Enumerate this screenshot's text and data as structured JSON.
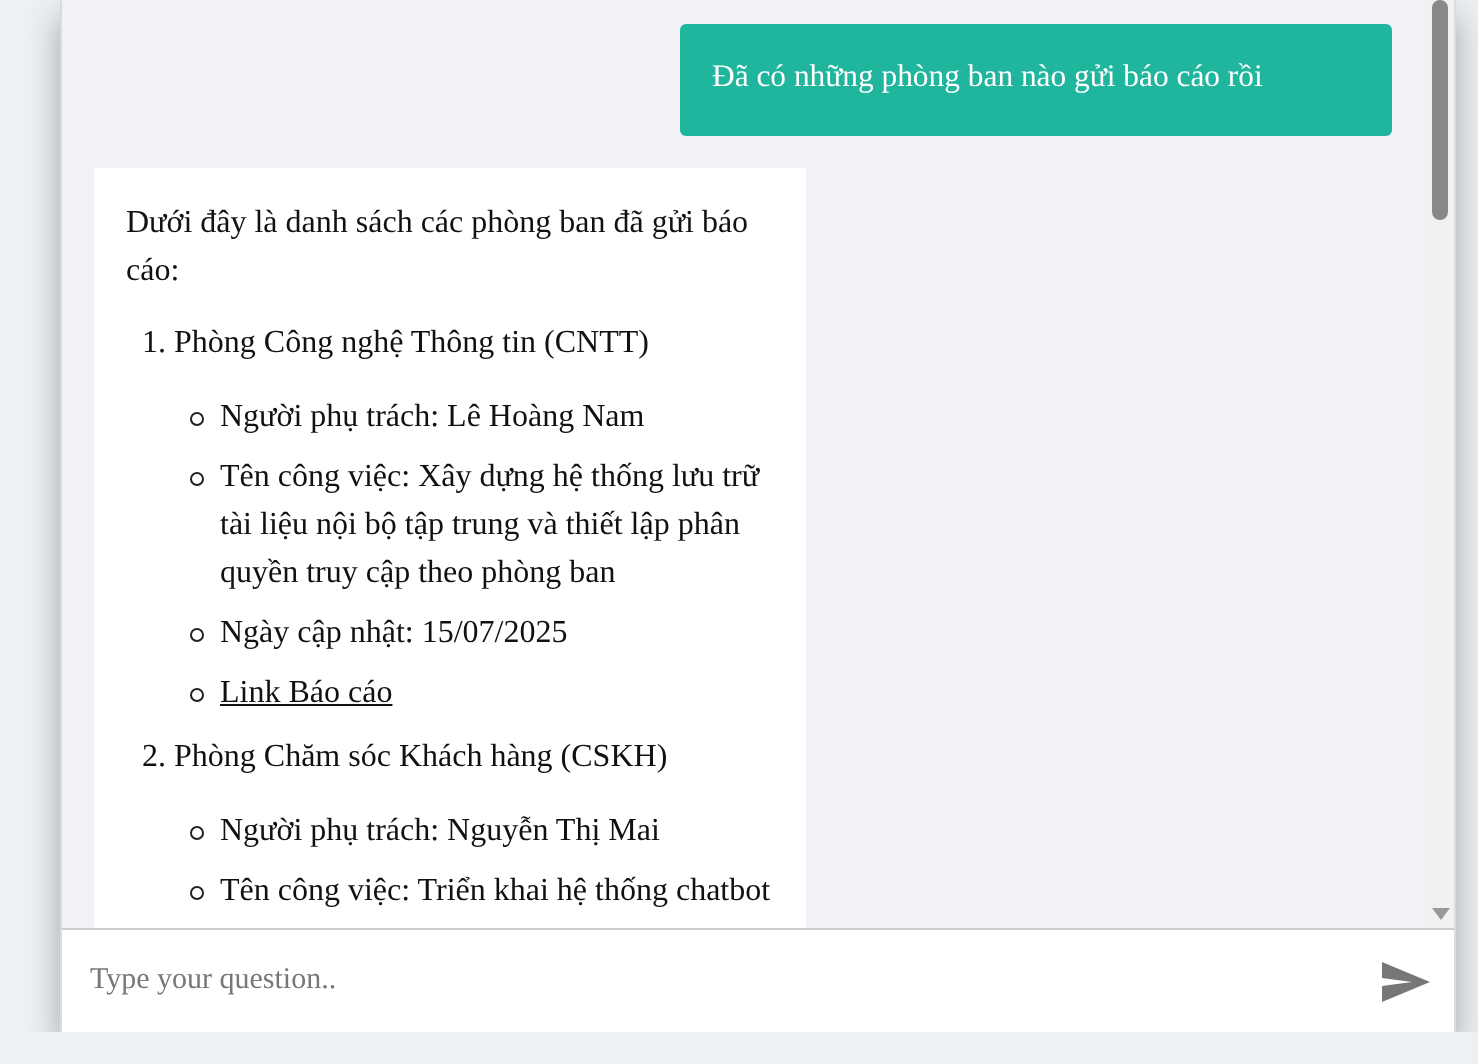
{
  "messages": [
    {
      "kind": "user",
      "text": "Đã có những phòng ban nào gửi báo cáo rồi"
    },
    {
      "kind": "bot",
      "intro": "Dưới đây là danh sách các phòng ban đã gửi báo cáo:",
      "departments": [
        {
          "number": "1.",
          "name": "Phòng Công nghệ Thông tin (CNTT)",
          "items": [
            {
              "kind": "text",
              "text": "Người phụ trách: Lê Hoàng Nam"
            },
            {
              "kind": "text",
              "text": "Tên công việc: Xây dựng hệ thống lưu trữ tài liệu nội bộ tập trung và thiết lập phân quyền truy cập theo phòng ban"
            },
            {
              "kind": "text",
              "text": "Ngày cập nhật: 15/07/2025"
            },
            {
              "kind": "link",
              "text": "Link Báo cáo"
            }
          ]
        },
        {
          "number": "2.",
          "name": "Phòng Chăm sóc Khách hàng (CSKH)",
          "items": [
            {
              "kind": "text",
              "text": "Người phụ trách: Nguyễn Thị Mai"
            },
            {
              "kind": "text",
              "text": "Tên công việc: Triển khai hệ thống chatbot"
            }
          ]
        }
      ]
    }
  ],
  "input": {
    "placeholder": "Type your question.."
  }
}
